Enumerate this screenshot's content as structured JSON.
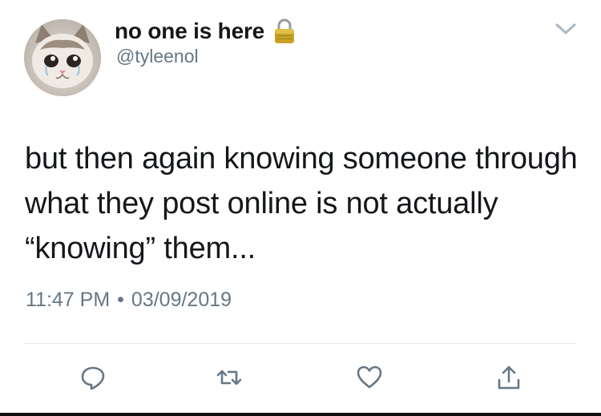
{
  "author": {
    "display_name": "no one is here",
    "handle": "@tyleenol",
    "protected_icon": "lock-icon",
    "avatar": "crying-cat-avatar"
  },
  "menu_icon": "chevron-down-icon",
  "tweet": {
    "text": "but then again knowing someone through what they post online is not actually “knowing” them...",
    "time": "11:47 PM",
    "separator": "•",
    "date": "03/09/2019"
  },
  "actions": [
    {
      "name": "reply",
      "icon": "reply-icon"
    },
    {
      "name": "retweet",
      "icon": "retweet-icon"
    },
    {
      "name": "like",
      "icon": "heart-icon"
    },
    {
      "name": "share",
      "icon": "share-icon"
    }
  ],
  "colors": {
    "text": "#14171a",
    "secondary": "#657786",
    "divider": "#e1e8ed",
    "icon": "#657786",
    "lock_gold": "#c9a227"
  }
}
